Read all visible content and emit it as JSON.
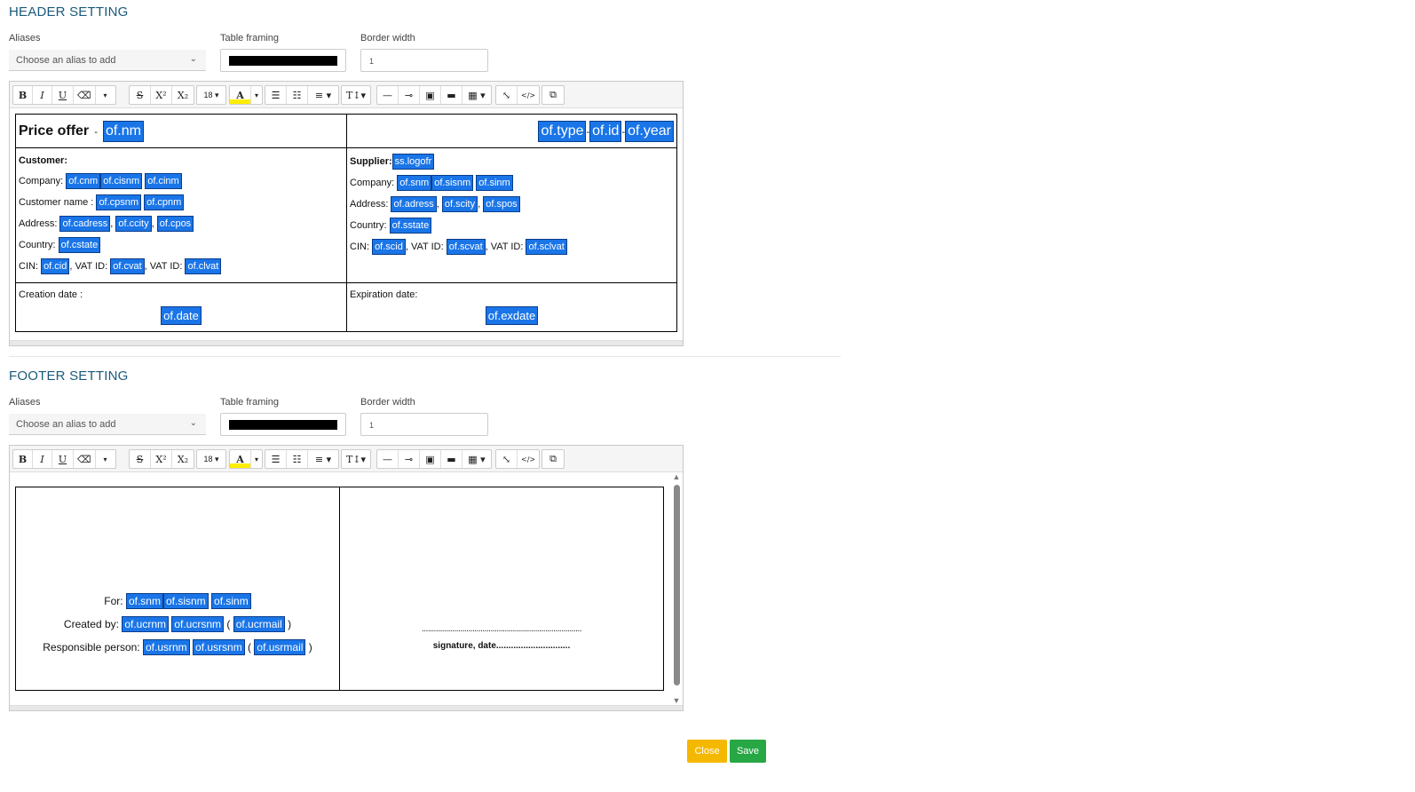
{
  "header": {
    "title": "HEADER SETTING",
    "aliases_label": "Aliases",
    "aliases_placeholder": "Choose an alias to add",
    "framing_label": "Table framing",
    "framing_color": "#000000",
    "border_label": "Border width",
    "border_value": "1",
    "doc": {
      "price_offer": "Price offer",
      "dash": "-",
      "nm": "of.nm",
      "type": "of.type",
      "id": "of.id",
      "year": "of.year",
      "customer": {
        "heading": "Customer:",
        "company_label": "Company:",
        "company_tags": [
          "of.cnm",
          "of.cisnm",
          "of.cinm"
        ],
        "name_label": "Customer name :",
        "name_tags": [
          "of.cpsnm",
          "of.cpnm"
        ],
        "address_label": "Address:",
        "address_tags": [
          "of.cadress",
          "of.ccity",
          "of.cpos"
        ],
        "country_label": "Country:",
        "country_tag": "of.cstate",
        "cin_label": "CIN:",
        "cin_tag": "of.cid",
        "vat_label": ", VAT ID:",
        "vat_tag": "of.cvat",
        "vat2_label": ", VAT ID:",
        "vat2_tag": "of.clvat"
      },
      "supplier": {
        "heading": "Supplier:",
        "logo_tag": "ss.logofr",
        "company_label": "Company:",
        "company_tags": [
          "of.snm",
          "of.sisnm",
          "of.sinm"
        ],
        "address_label": "Address:",
        "address_tags": [
          "of.adress",
          "of.scity",
          "of.spos"
        ],
        "country_label": "Country:",
        "country_tag": "of.sstate",
        "cin_label": "CIN:",
        "cin_tag": "of.scid",
        "vat_label": ", VAT ID:",
        "vat_tag": "of.scvat",
        "vat2_label": ", VAT ID:",
        "vat2_tag": "of.sclvat"
      },
      "creation_label": "Creation date :",
      "creation_tag": "of.date",
      "expiration_label": "Expiration date:",
      "expiration_tag": "of.exdate"
    }
  },
  "footer": {
    "title": "FOOTER SETTING",
    "aliases_label": "Aliases",
    "aliases_placeholder": "Choose an alias to add",
    "framing_label": "Table framing",
    "framing_color": "#000000",
    "border_label": "Border width",
    "border_value": "1",
    "doc": {
      "for_label": "For:",
      "for_tags": [
        "of.snm",
        "of.sisnm",
        "of.sinm"
      ],
      "created_label": "Created by:",
      "created_tags": [
        "of.ucrnm",
        "of.ucrsnm"
      ],
      "created_mail": "of.ucrmail",
      "resp_label": "Responsible person:",
      "resp_tags": [
        "of.usrnm",
        "of.usrsnm"
      ],
      "resp_mail": "of.usrmail",
      "open_paren": "(",
      "close_paren": ")",
      "dots": "...............................................................................",
      "signature": "signature, date.............................."
    }
  },
  "toolbar": {
    "bold": "B",
    "italic": "I",
    "underline": "U",
    "eraser": "⌫",
    "caret": "▾",
    "strike": "S",
    "sup": "X²",
    "sub": "X₂",
    "size": "18 ▾",
    "color": "A",
    "ul": "☰",
    "ol": "☷",
    "align": "≡ ▾",
    "height": "T↕▾",
    "hr": "—",
    "link": "⊸",
    "image": "▣",
    "video": "▬",
    "table": "▦ ▾",
    "fullscreen": "⤡",
    "code": "</>",
    "help": "⧉"
  },
  "actions": {
    "close": "Close",
    "save": "Save"
  },
  "colors": {
    "close": "#f5b800",
    "save": "#28a745",
    "tag": "#1a75e8"
  }
}
